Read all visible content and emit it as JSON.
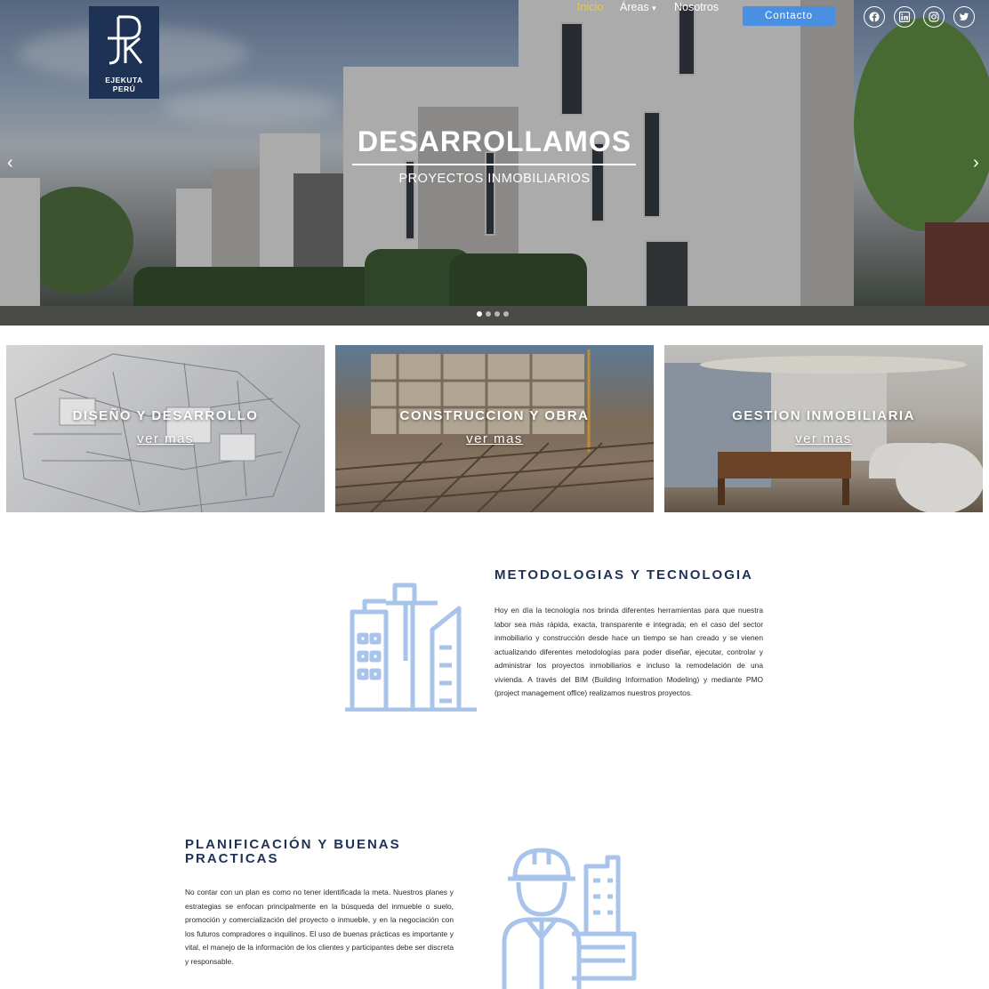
{
  "brand": {
    "name_line1": "EJEKUTA",
    "name_line2": "PERÚ",
    "color": "#1e3256"
  },
  "nav": {
    "items": [
      {
        "label": "Inicio",
        "active": true
      },
      {
        "label": "Áreas",
        "has_dropdown": true
      },
      {
        "label": "Nosotros"
      }
    ],
    "contact_label": "Contacto",
    "social": [
      "facebook-icon",
      "linkedin-icon",
      "instagram-icon",
      "twitter-icon"
    ]
  },
  "hero": {
    "title": "DESARROLLAMOS",
    "subtitle": "PROYECTOS INMOBILIARIOS",
    "prev": "‹",
    "next": "›",
    "slides_count": 4,
    "active_slide": 1
  },
  "cards": [
    {
      "title": "DISEÑO Y DESARROLLO",
      "link": "ver mas"
    },
    {
      "title": "CONSTRUCCION Y OBRA",
      "link": "ver mas"
    },
    {
      "title": "GESTION INMOBILIARIA",
      "link": "ver mas"
    }
  ],
  "section1": {
    "title": "METODOLOGIAS Y TECNOLOGIA",
    "body": "Hoy en día la tecnología nos brinda diferentes herramientas para que nuestra labor sea más rápida, exacta, transparente e integrada; en el caso del sector inmobiliario y construcción desde hace un tiempo se han creado y se vienen actualizando diferentes metodologías para poder diseñar, ejecutar, controlar y administrar los proyectos inmobiliarios e incluso la remodelación de una vivienda. A través del BIM (Building Information Modeling) y mediante PMO (project management office) realizamos nuestros proyectos."
  },
  "section2": {
    "title": "PLANIFICACIÓN Y BUENAS PRACTICAS",
    "body": "No contar con un plan es como no tener identificada la meta. Nuestros planes y estrategias se enfocan principalmente en la búsqueda del inmueble o suelo, promoción y comercialización del proyecto o inmueble, y en la negociación con los futuros compradores o inquilinos. El uso de buenas prácticas es importante y vital, el manejo de la información de los clientes y participantes debe ser discreta y responsable."
  },
  "colors": {
    "accent": "#4a90e2",
    "active_nav": "#f2c24a",
    "illustration": "#a9c4ea"
  }
}
